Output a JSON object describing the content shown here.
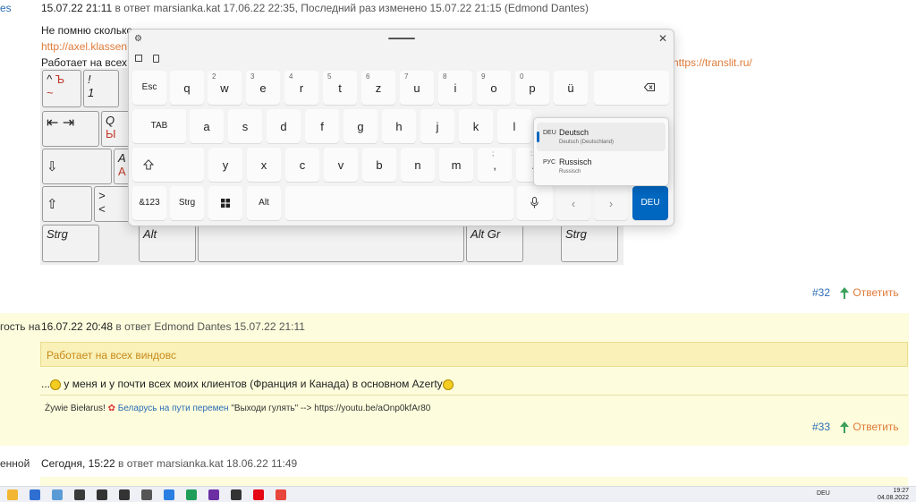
{
  "post1": {
    "left_cut": "es",
    "time": "15.07.22 21:11",
    "in_reply_prefix": "в ответ",
    "reply_to": "marsianka.kat 17.06.22 22:35,",
    "edited_prefix": "Последний раз изменено",
    "edited": "15.07.22 21:15 (Edmond Dantes)",
    "line1": "Не помню сколько",
    "link1": "http://axel.klassen.",
    "line3": "Работает на всех в",
    "link2": "https://translit.ru/"
  },
  "keyboard_image": {
    "keys": [
      {
        "top": "Ъ",
        "bottom": "~",
        "sym": "^"
      },
      {
        "top": "!",
        "bottom": "1"
      },
      {
        "label": "⇤ ⇥"
      },
      {
        "top": "Q",
        "bottom": "Ы"
      },
      {
        "label": "⇩"
      },
      {
        "top": "A",
        "bottom": "А"
      },
      {
        "label": "⇧"
      },
      {
        "top": ">",
        "bottom": "<"
      },
      {
        "label": "Strg"
      },
      {
        "label": "Alt"
      },
      {
        "label": "Alt Gr"
      },
      {
        "label": "Strg"
      }
    ]
  },
  "post1_footer": {
    "num": "#32",
    "reply": "Ответить"
  },
  "post2": {
    "left_cut": "гость на",
    "time": "16.07.22 20:48",
    "in_reply_prefix": "в ответ",
    "reply_to": "Edmond Dantes 15.07.22 21:11",
    "quote": "Работает на всех виндовс",
    "body_prefix": "...",
    "body": "у меня и у почти всех моих клиентов (Франция и Канада) в основном Azerty",
    "sig_prefix": "Żywie Biełarus!",
    "sig_link": "Беларусь на пути перемен",
    "sig_rest": "\"Выходи гулять\" --> https://youtu.be/aOnp0kfAr80",
    "num": "#33",
    "reply": "Ответить"
  },
  "post3": {
    "left_cut": "енной",
    "time": "Сегодня, 15:22",
    "in_reply_prefix": "в ответ",
    "reply_to": "marsianka.kat 18.06.22 11:49"
  },
  "osk": {
    "row1": [
      {
        "main": "Esc"
      },
      {
        "main": "q",
        "sub": ""
      },
      {
        "main": "w",
        "sub": "2"
      },
      {
        "main": "e",
        "sub": "3"
      },
      {
        "main": "r",
        "sub": "4"
      },
      {
        "main": "t",
        "sub": "5"
      },
      {
        "main": "z",
        "sub": "6"
      },
      {
        "main": "u",
        "sub": "7"
      },
      {
        "main": "i",
        "sub": "8"
      },
      {
        "main": "o",
        "sub": "9"
      },
      {
        "main": "p",
        "sub": "0"
      },
      {
        "main": "ü"
      }
    ],
    "row2": [
      {
        "main": "TAB"
      },
      {
        "main": "a"
      },
      {
        "main": "s"
      },
      {
        "main": "d"
      },
      {
        "main": "f"
      },
      {
        "main": "g"
      },
      {
        "main": "h"
      },
      {
        "main": "j"
      },
      {
        "main": "k"
      },
      {
        "main": "l"
      }
    ],
    "row3": [
      {
        "main": "y"
      },
      {
        "main": "x"
      },
      {
        "main": "c"
      },
      {
        "main": "v"
      },
      {
        "main": "b"
      },
      {
        "main": "n"
      },
      {
        "main": "m"
      },
      {
        "main": ",",
        "sub": ";"
      },
      {
        "main": ".",
        "sub": ":"
      }
    ],
    "row4": {
      "num": "&123",
      "ctrl": "Strg",
      "alt": "Alt",
      "lang": "DEU"
    },
    "lang_menu": [
      {
        "code": "DEU",
        "name": "Deutsch",
        "sub": "Deutsch (Deutschland)"
      },
      {
        "code": "РУС",
        "name": "Russisch",
        "sub": "Russisch"
      }
    ]
  },
  "taskbar": {
    "lang": "DEU",
    "time": "19:27",
    "date": "04.08.2022",
    "icon_colors": [
      "#f2b632",
      "#2f6fd1",
      "#5b9bd5",
      "#3a3a3a",
      "#333333",
      "#333333",
      "#555555",
      "#2a7de1",
      "#1f9e5a",
      "#6b2fa3",
      "#333333",
      "#e50914",
      "#e8453c"
    ]
  }
}
